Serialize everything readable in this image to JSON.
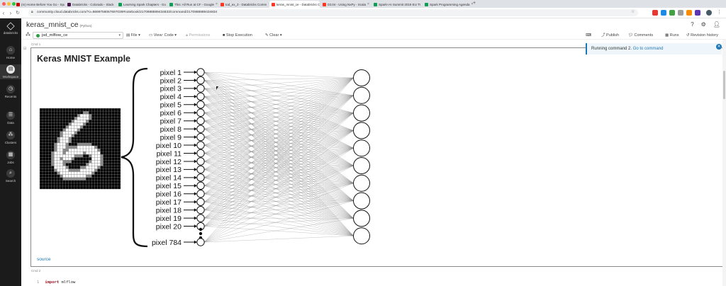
{
  "browser": {
    "tabs": [
      {
        "label": "(m) Home Before You Go - Spark",
        "color": "#cc0000"
      },
      {
        "label": "Databricks - Colorado - Slack",
        "color": "#4a154b"
      },
      {
        "label": "Learning Spark Chapters - Go",
        "color": "#0f9d58"
      },
      {
        "label": "This: All Run at CF - Google",
        "color": "#0f9d58"
      },
      {
        "label": "tod_ex_3 - Databricks Comm",
        "color": "#ff3621"
      },
      {
        "label": "keras_mnist_ce - Databricks C",
        "color": "#ff3621"
      },
      {
        "label": "03.04 - Using NxPy - Scala",
        "color": "#ff3621"
      },
      {
        "label": "Spark+AI Summit 2019 EU Tr",
        "color": "#0f9d58"
      },
      {
        "label": "Spark Programming Agenda",
        "color": "#0f9d58"
      }
    ],
    "url": "community.cloud.databricks.com/?o=8699758067697039#notebook/2170988889434833/command/2170988889434834"
  },
  "sidebar": {
    "brand": "databricks",
    "items": [
      {
        "label": "Home",
        "glyph": "⌂"
      },
      {
        "label": "Workspace",
        "glyph": "▤"
      },
      {
        "label": "Recents",
        "glyph": "◷"
      },
      {
        "label": "Data",
        "glyph": "☰"
      },
      {
        "label": "Clusters",
        "glyph": "⁂"
      },
      {
        "label": "Jobs",
        "glyph": "▦"
      },
      {
        "label": "Search",
        "glyph": "⌕"
      }
    ]
  },
  "notebook": {
    "title": "keras_mnist_ce",
    "language": "(Python)"
  },
  "toolbar": {
    "cluster": "jsd_mlflow_ce",
    "file": "File",
    "view": "View: Code",
    "permissions": "Permissions",
    "stop": "Stop Execution",
    "clear": "Clear",
    "publish": "Publish",
    "comments": "Comments",
    "runs": "Runs",
    "revision": "Revision history"
  },
  "toast": {
    "text": "Running command 2.",
    "link": "Go to command"
  },
  "cell1": {
    "header": "Cmd 1",
    "title": "Keras MNIST Example",
    "source": "source",
    "pixel_labels": [
      "pixel 1",
      "pixel 2",
      "pixel 3",
      "pixel 4",
      "pixel 5",
      "pixel 6",
      "pixel 7",
      "pixel 8",
      "pixel 9",
      "pixel 10",
      "pixel 11",
      "pixel 12",
      "pixel 13",
      "pixel 14",
      "pixel 15",
      "pixel 16",
      "pixel 17",
      "pixel 18",
      "pixel 19",
      "pixel 20"
    ],
    "last_pixel": "pixel 784",
    "output_nodes": 10
  },
  "cell2": {
    "header": "Cmd 2",
    "line_no": "1",
    "keyword": "import",
    "module": "mlflow"
  }
}
